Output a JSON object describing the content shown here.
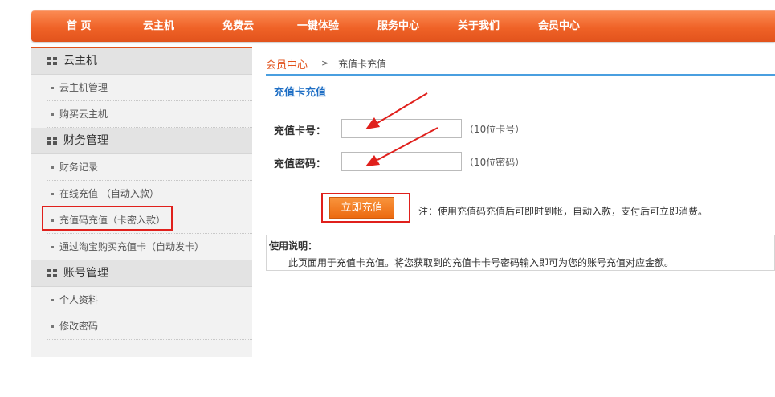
{
  "nav": {
    "items": [
      {
        "label": "首 页"
      },
      {
        "label": "云主机"
      },
      {
        "label": "免费云"
      },
      {
        "label": "一键体验"
      },
      {
        "label": "服务中心"
      },
      {
        "label": "关于我们"
      },
      {
        "label": "会员中心"
      }
    ]
  },
  "sidebar": {
    "groups": [
      {
        "icon": "grid-icon",
        "label": "云主机",
        "items": [
          {
            "label": "云主机管理"
          },
          {
            "label": "购买云主机"
          }
        ]
      },
      {
        "icon": "grid-icon",
        "label": "财务管理",
        "items": [
          {
            "label": "财务记录"
          },
          {
            "label": "在线充值 （自动入款）"
          },
          {
            "label": "充值码充值（卡密入款）"
          },
          {
            "label": "通过淘宝购买充值卡（自动发卡）"
          }
        ]
      },
      {
        "icon": "grid-icon",
        "label": "账号管理",
        "items": [
          {
            "label": "个人资料"
          },
          {
            "label": "修改密码"
          }
        ]
      }
    ]
  },
  "breadcrumb": {
    "home": "会员中心",
    "separator": ">",
    "current": "充值卡充值"
  },
  "form": {
    "title": "充值卡充值",
    "card_number_label": "充值卡号：",
    "card_number_value": "",
    "card_number_hint": "（10位卡号）",
    "card_password_label": "充值密码：",
    "card_password_value": "",
    "card_password_hint": "（10位密码）",
    "submit_label": "立即充值",
    "note": "注：使用充值码充值后可即时到帐，自动入款，支付后可立即消费。"
  },
  "usage": {
    "title": "使用说明：",
    "text": "此页面用于充值卡充值。将您获取到的充值卡卡号密码输入即可为您的账号充值对应金额。"
  },
  "colors": {
    "nav_orange": "#ef6227",
    "accent_blue": "#1f6fc5",
    "annotation_red": "#e0201c"
  }
}
